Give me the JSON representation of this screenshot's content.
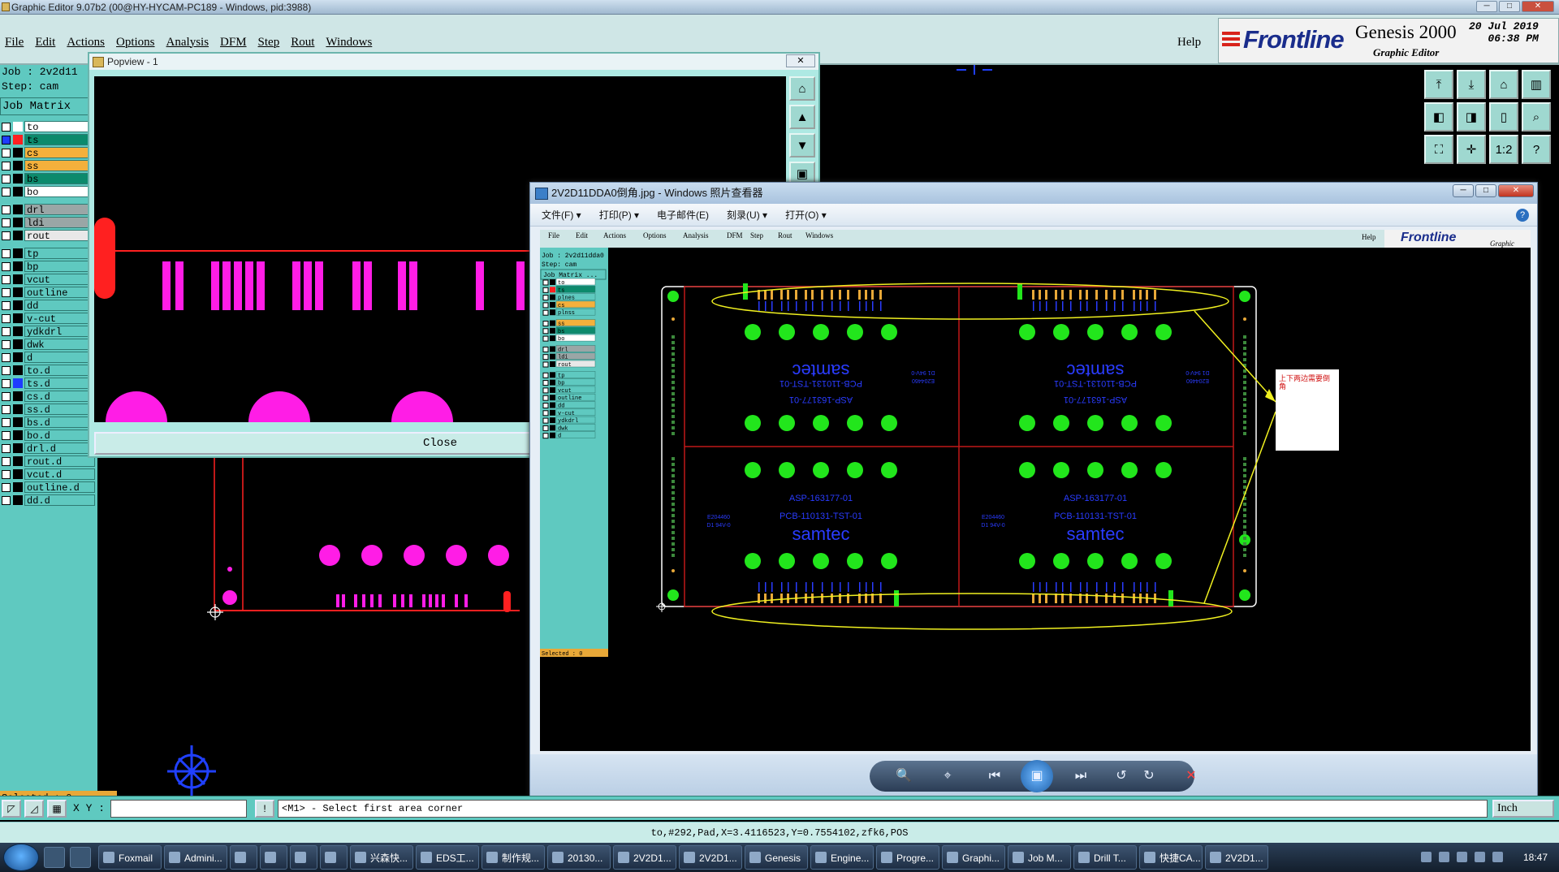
{
  "app": {
    "title": "Graphic Editor 9.07b2 (00@HY-HYCAM-PC189 - Windows, pid:3988)",
    "menu": [
      "File",
      "Edit",
      "Actions",
      "Options",
      "Analysis",
      "DFM",
      "Step",
      "Rout",
      "Windows"
    ],
    "help": "Help",
    "brand": {
      "logo": "Frontline",
      "product": "Genesis 2000",
      "subtitle": "Graphic Editor",
      "date": "20 Jul 2019",
      "time": "06:38 PM"
    }
  },
  "job_panel": {
    "job_label": "Job : 2v2d11",
    "step_label": "Step: cam",
    "matrix_label": "Job Matrix",
    "layers_group1": [
      {
        "name": "to",
        "swatch": "#ffffff",
        "bg": "#ffffff"
      },
      {
        "name": "ts",
        "swatch": "#ff2020",
        "bg": "#0c8a6c",
        "selected": true
      },
      {
        "name": "cs",
        "swatch": "#000000",
        "bg": "#f4b03c"
      },
      {
        "name": "ss",
        "swatch": "#000000",
        "bg": "#f4b03c"
      },
      {
        "name": "bs",
        "swatch": "#000000",
        "bg": "#0c8a6c"
      },
      {
        "name": "bo",
        "swatch": "#000000",
        "bg": "#ffffff"
      }
    ],
    "layers_group2": [
      {
        "name": "drl",
        "swatch": "#000000",
        "bg": "#9aa6a6"
      },
      {
        "name": "ldi",
        "swatch": "#000000",
        "bg": "#9aa6a6"
      },
      {
        "name": "rout",
        "swatch": "#000000",
        "bg": "#e8e8e8"
      }
    ],
    "layers_group3": [
      {
        "name": "tp",
        "swatch": "#000000",
        "bg": "#5fc9c0"
      },
      {
        "name": "bp",
        "swatch": "#000000",
        "bg": "#5fc9c0"
      },
      {
        "name": "vcut",
        "swatch": "#000000",
        "bg": "#5fc9c0"
      },
      {
        "name": "outline",
        "swatch": "#000000",
        "bg": "#5fc9c0"
      },
      {
        "name": "dd",
        "swatch": "#000000",
        "bg": "#5fc9c0"
      },
      {
        "name": "v-cut",
        "swatch": "#000000",
        "bg": "#5fc9c0"
      },
      {
        "name": "ydkdrl",
        "swatch": "#000000",
        "bg": "#5fc9c0"
      },
      {
        "name": "dwk",
        "swatch": "#000000",
        "bg": "#5fc9c0"
      },
      {
        "name": "d",
        "swatch": "#000000",
        "bg": "#5fc9c0"
      },
      {
        "name": "to.d",
        "swatch": "#000000",
        "bg": "#5fc9c0"
      },
      {
        "name": "ts.d",
        "swatch": "#1e3cff",
        "bg": "#5fc9c0"
      },
      {
        "name": "cs.d",
        "swatch": "#000000",
        "bg": "#5fc9c0"
      },
      {
        "name": "ss.d",
        "swatch": "#000000",
        "bg": "#5fc9c0"
      },
      {
        "name": "bs.d",
        "swatch": "#000000",
        "bg": "#5fc9c0"
      },
      {
        "name": "bo.d",
        "swatch": "#000000",
        "bg": "#5fc9c0"
      },
      {
        "name": "drl.d",
        "swatch": "#000000",
        "bg": "#5fc9c0"
      },
      {
        "name": "rout.d",
        "swatch": "#000000",
        "bg": "#5fc9c0"
      },
      {
        "name": "vcut.d",
        "swatch": "#000000",
        "bg": "#5fc9c0"
      },
      {
        "name": "outline.d",
        "swatch": "#000000",
        "bg": "#5fc9c0"
      },
      {
        "name": "dd.d",
        "swatch": "#000000",
        "bg": "#5fc9c0"
      }
    ],
    "selected": "Selected : 0"
  },
  "popview": {
    "title": "Popview - 1",
    "close_x": "✕",
    "close_button": "Close"
  },
  "viewer": {
    "title": "2V2D11DDA0倒角.jpg - Windows 照片查看器",
    "menu": [
      "文件(F) ▾",
      "打印(P) ▾",
      "电子邮件(E)",
      "刻录(U) ▾",
      "打开(O) ▾"
    ],
    "help": "?",
    "image": {
      "menu": [
        "File",
        "Edit",
        "Actions",
        "Options",
        "Analysis",
        "DFM",
        "Step",
        "Rout",
        "Windows"
      ],
      "help": "Help",
      "logo": "Frontline",
      "graphic": "Graphic",
      "job": "Job : 2v2d11dda0",
      "step": "Step: cam",
      "matrix": "Job Matrix ...",
      "layers": [
        "to",
        "ts",
        "plnes",
        "cs",
        "plnss",
        "ss",
        "bs",
        "bo",
        "drl",
        "ldi",
        "rout",
        "tp",
        "bp",
        "vcut",
        "outline",
        "dd",
        "v-cut",
        "ydkdrl",
        "dwk",
        "d"
      ],
      "selected": "Selected : 0",
      "board_text": {
        "brand": "samtec",
        "pcb": "PCB-110131-TST-01",
        "asp": "ASP-163177-01",
        "ul": "E204460",
        "rating": "D1 94V-0"
      },
      "annotation": "上下两边需要倒角"
    },
    "controls": [
      "🔍",
      "⌖",
      "⏮",
      "▣",
      "⏭",
      "↺",
      "↻",
      "✕"
    ]
  },
  "bottom": {
    "xy_label": "X Y :",
    "xy_value": "",
    "prompt": "<M1> - Select first area corner",
    "units": "Inch",
    "status": "to,#292,Pad,X=3.4116523,Y=0.7554102,zfk6,POS"
  },
  "taskbar": {
    "tasks": [
      "Foxmail",
      "Admini...",
      "",
      "",
      "",
      "",
      "兴森快...",
      "EDS工...",
      "制作规...",
      "20130...",
      "2V2D1...",
      "2V2D1...",
      "Genesis",
      "Engine...",
      "Progre...",
      "Graphi...",
      "Job M...",
      "Drill T...",
      "快捷CA...",
      "2V2D1..."
    ],
    "clock": "18:47"
  },
  "colors": {
    "bg_teal": "#5fc9c0",
    "magenta": "#ff1de6",
    "pad_green": "#22e61c",
    "pad_orange": "#e8a838",
    "annotation_yellow": "#f0f020"
  }
}
